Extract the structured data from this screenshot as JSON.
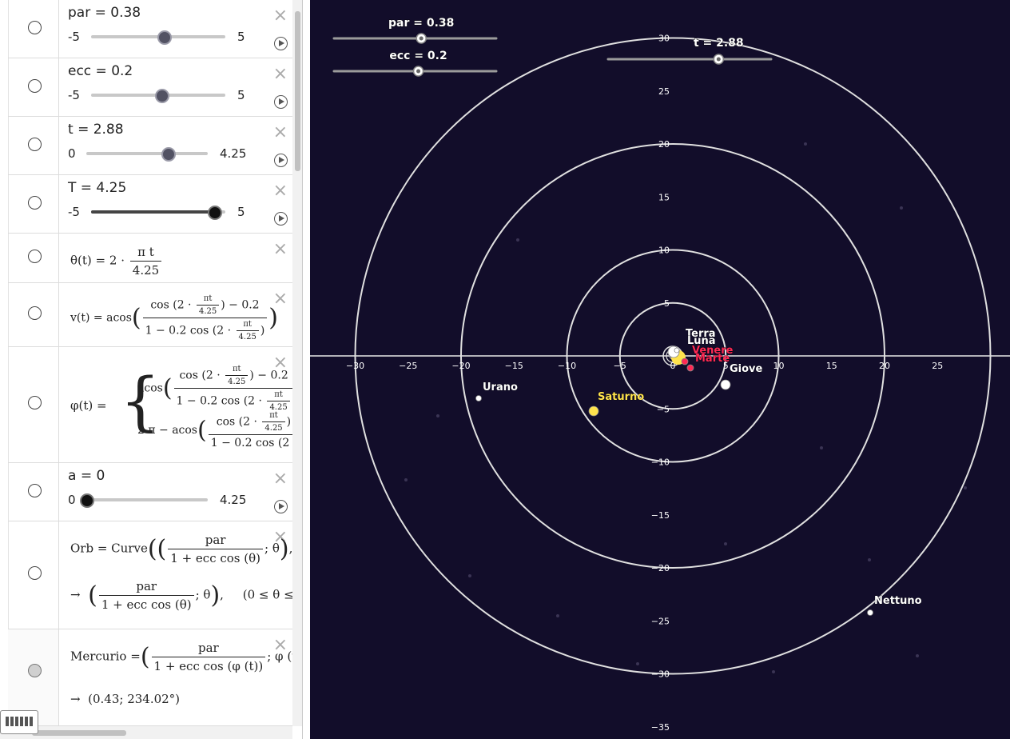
{
  "algebra": {
    "rows": [
      {
        "type": "slider",
        "label": "par = 0.38",
        "min": "-5",
        "max": "5",
        "value": 0.538
      },
      {
        "type": "slider",
        "label": "ecc = 0.2",
        "min": "-5",
        "max": "5",
        "value": 0.52
      },
      {
        "type": "slider",
        "label": "t = 2.88",
        "min": "0",
        "max": "4.25",
        "value": 0.678
      },
      {
        "type": "slider",
        "label": "T = 4.25",
        "min": "-5",
        "max": "5",
        "value": 0.925
      },
      {
        "type": "formula",
        "id": "theta"
      },
      {
        "type": "formula",
        "id": "v"
      },
      {
        "type": "formula",
        "id": "phi"
      },
      {
        "type": "slider",
        "label": "a = 0",
        "min": "0",
        "max": "4.25",
        "value": 0.0
      },
      {
        "type": "formula",
        "id": "orb"
      },
      {
        "type": "formula",
        "id": "mercurio"
      }
    ],
    "theta": {
      "lhs": "θ(t)",
      "eq": "=",
      "coef": "2 ·",
      "num": "π t",
      "den": "4.25"
    },
    "v": {
      "lhs": "v(t)",
      "eq": "=",
      "fn": "acos",
      "num_a": "cos",
      "num_b": "2 ·",
      "num_c": "πt",
      "num_d": "4.25",
      "num_e": ") − 0.2",
      "den_a": "1 − 0.2  cos",
      "den_b": "2 ·",
      "den_c": "πt",
      "den_d": "4.25"
    },
    "phi": {
      "lhs": "φ(t)",
      "eq": "=",
      "l1": "acos",
      "l2": "2 π − acos",
      "num": "cos",
      "numtail": ") − 0.2",
      "den": "1 − 0.2  cos",
      "dot": "2 ·",
      "pit": "πt",
      "per": "4.25"
    },
    "orb": {
      "lhs": "Orb = Curve",
      "num": "par",
      "den": "1 + ecc  cos (θ)",
      "sep": "; θ",
      "tail": ", θ",
      "arrow": "→",
      "range": "(0 ≤ θ ≤"
    },
    "mercurio": {
      "lhs": "Mercurio =",
      "num": "par",
      "den": "1 + ecc  cos (φ (t))",
      "sep": "; φ (t)",
      "arrow": "→",
      "result": "(0.43; 234.02°)"
    }
  },
  "graph": {
    "sliders": [
      {
        "label": "par = 0.38",
        "value": 0.538
      },
      {
        "label": "ecc = 0.2",
        "value": 0.52
      },
      {
        "label": "t = 2.88",
        "value": 0.678
      }
    ],
    "x_ticks": [
      "−30",
      "−25",
      "−20",
      "−15",
      "−10",
      "−5",
      "0",
      "5",
      "10",
      "15",
      "20",
      "25"
    ],
    "y_ticks": [
      "30",
      "25",
      "20",
      "15",
      "10",
      "5",
      "−5",
      "−10",
      "−15",
      "−20",
      "−25",
      "−30",
      "−35"
    ],
    "circle_radii": [
      5,
      10,
      20,
      30
    ],
    "planets": [
      {
        "name": "Terra",
        "color": "#ffffff"
      },
      {
        "name": "Luna",
        "color": "#ffffff"
      },
      {
        "name": "Venere",
        "color": "#ff2a55"
      },
      {
        "name": "Marte",
        "color": "#ff2a55"
      },
      {
        "name": "Giove",
        "color": "#ffffff"
      },
      {
        "name": "Saturno",
        "color": "#ffe34d"
      },
      {
        "name": "Urano",
        "color": "#ffffff"
      },
      {
        "name": "Nettuno",
        "color": "#ffffff"
      }
    ],
    "colors": {
      "background": "#120d2a",
      "axis": "#e8e8e8",
      "circle": "#e0e0e0"
    }
  }
}
